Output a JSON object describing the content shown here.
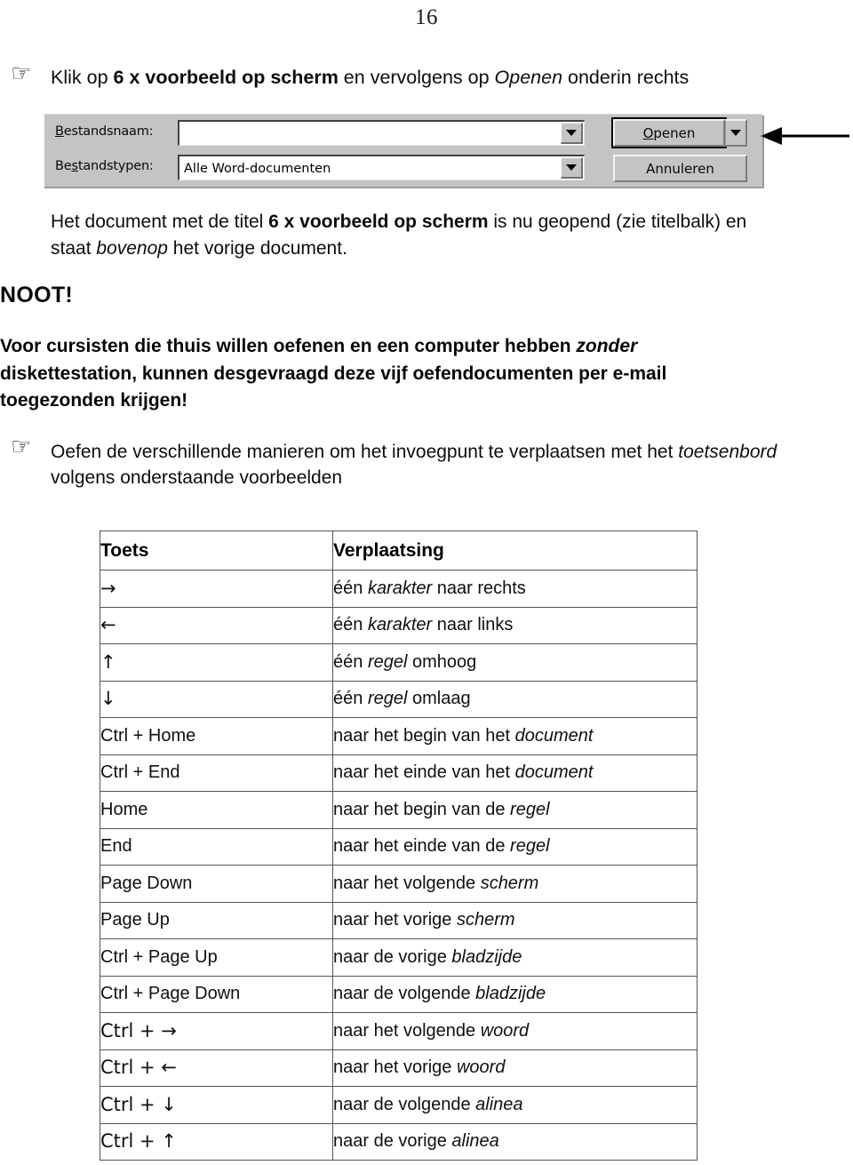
{
  "page": {
    "number": "16"
  },
  "icons": {
    "hand": "☞",
    "dropdown": "chevron-down-icon",
    "annotation_arrow": "left-arrow-icon"
  },
  "instruction_1": {
    "parts": [
      {
        "text": "Klik op ",
        "style": "normal"
      },
      {
        "text": "6 x voorbeeld op scherm",
        "style": "bold"
      },
      {
        "text": " en vervolgens op ",
        "style": "normal"
      },
      {
        "text": "Openen",
        "style": "italic"
      },
      {
        "text": " onderin rechts",
        "style": "normal"
      }
    ],
    "plain": "Klik op 6 x voorbeeld op scherm en vervolgens op Openen onderin rechts"
  },
  "dialog": {
    "name": "open-file-dialog",
    "filename_label": "Bestandsnaam:",
    "filename_label_accel": "B",
    "filename_value": "",
    "filetype_label": "Bestandstypen:",
    "filetype_label_accel": "s",
    "filetype_value": "Alle Word-documenten",
    "open_button": "Openen",
    "open_button_accel": "O",
    "cancel_button": "Annuleren",
    "colors": {
      "face": "#c4c4c4",
      "field": "#ffffff",
      "shadow": "#7d7d7d",
      "highlight": "#f4f4f4"
    }
  },
  "paragraph_1": {
    "parts": [
      {
        "text": "Het document met de titel ",
        "style": "normal"
      },
      {
        "text": "6 x voorbeeld op scherm",
        "style": "bold"
      },
      {
        "text": " is nu geopend (zie titelbalk) en",
        "style": "normal"
      }
    ],
    "line2": [
      {
        "text": "staat ",
        "style": "normal"
      },
      {
        "text": "bovenop",
        "style": "italic"
      },
      {
        "text": " het vorige document.",
        "style": "normal"
      }
    ]
  },
  "noot": {
    "heading": "NOOT!",
    "body_lines": [
      [
        {
          "text": "Voor cursisten die thuis willen oefenen en een computer hebben ",
          "style": "bold"
        },
        {
          "text": "zonder",
          "style": "bold-italic"
        }
      ],
      [
        {
          "text": "diskettestation, kunnen desgevraagd deze vijf oefendocumenten per e-mail",
          "style": "bold"
        }
      ],
      [
        {
          "text": "toegezonden krijgen!",
          "style": "bold"
        }
      ]
    ]
  },
  "instruction_2": {
    "line1": [
      {
        "text": "Oefen de verschillende manieren om het invoegpunt te verplaatsen met het ",
        "style": "normal"
      },
      {
        "text": "toetsenbord",
        "style": "italic"
      }
    ],
    "line2": [
      {
        "text": "volgens onderstaande voorbeelden",
        "style": "normal"
      }
    ]
  },
  "kbd_table": {
    "headers": [
      "Toets",
      "Verplaatsing"
    ],
    "rows": [
      {
        "key": "→",
        "key_is_glyph": true,
        "desc": [
          {
            "text": "één ",
            "style": "normal"
          },
          {
            "text": "karakter",
            "style": "italic"
          },
          {
            "text": " naar rechts",
            "style": "normal"
          }
        ]
      },
      {
        "key": "←",
        "key_is_glyph": true,
        "desc": [
          {
            "text": "één ",
            "style": "normal"
          },
          {
            "text": "karakter",
            "style": "italic"
          },
          {
            "text": " naar links",
            "style": "normal"
          }
        ]
      },
      {
        "key": "↑",
        "key_is_glyph": true,
        "desc": [
          {
            "text": "één ",
            "style": "normal"
          },
          {
            "text": "regel",
            "style": "italic"
          },
          {
            "text": " omhoog",
            "style": "normal"
          }
        ]
      },
      {
        "key": "↓",
        "key_is_glyph": true,
        "desc": [
          {
            "text": "één ",
            "style": "normal"
          },
          {
            "text": "regel",
            "style": "italic"
          },
          {
            "text": " omlaag",
            "style": "normal"
          }
        ]
      },
      {
        "key": "Ctrl + Home",
        "key_is_glyph": false,
        "desc": [
          {
            "text": "naar het begin van het ",
            "style": "normal"
          },
          {
            "text": "document",
            "style": "italic"
          }
        ]
      },
      {
        "key": "Ctrl + End",
        "key_is_glyph": false,
        "desc": [
          {
            "text": "naar het einde van het ",
            "style": "normal"
          },
          {
            "text": "document",
            "style": "italic"
          }
        ]
      },
      {
        "key": "Home",
        "key_is_glyph": false,
        "desc": [
          {
            "text": "naar het begin van de ",
            "style": "normal"
          },
          {
            "text": "regel",
            "style": "italic"
          }
        ]
      },
      {
        "key": "End",
        "key_is_glyph": false,
        "desc": [
          {
            "text": "naar het einde van de ",
            "style": "normal"
          },
          {
            "text": "regel",
            "style": "italic"
          }
        ]
      },
      {
        "key": "Page Down",
        "key_is_glyph": false,
        "desc": [
          {
            "text": "naar het volgende ",
            "style": "normal"
          },
          {
            "text": "scherm",
            "style": "italic"
          }
        ]
      },
      {
        "key": "Page Up",
        "key_is_glyph": false,
        "desc": [
          {
            "text": "naar het vorige ",
            "style": "normal"
          },
          {
            "text": "scherm",
            "style": "italic"
          }
        ]
      },
      {
        "key": "Ctrl + Page Up",
        "key_is_glyph": false,
        "desc": [
          {
            "text": "naar de vorige ",
            "style": "normal"
          },
          {
            "text": "bladzijde",
            "style": "italic"
          }
        ]
      },
      {
        "key": "Ctrl + Page Down",
        "key_is_glyph": false,
        "desc": [
          {
            "text": "naar de volgende ",
            "style": "normal"
          },
          {
            "text": "bladzijde",
            "style": "italic"
          }
        ]
      },
      {
        "key": "Ctrl + →",
        "key_is_glyph": true,
        "desc": [
          {
            "text": "naar het volgende ",
            "style": "normal"
          },
          {
            "text": "woord",
            "style": "italic"
          }
        ]
      },
      {
        "key": "Ctrl + ←",
        "key_is_glyph": true,
        "desc": [
          {
            "text": "naar het vorige ",
            "style": "normal"
          },
          {
            "text": "woord",
            "style": "italic"
          }
        ]
      },
      {
        "key": "Ctrl + ↓",
        "key_is_glyph": true,
        "desc": [
          {
            "text": "naar de volgende ",
            "style": "normal"
          },
          {
            "text": "alinea",
            "style": "italic"
          }
        ]
      },
      {
        "key": "Ctrl + ↑",
        "key_is_glyph": true,
        "desc": [
          {
            "text": "naar de vorige ",
            "style": "normal"
          },
          {
            "text": "alinea",
            "style": "italic"
          }
        ]
      }
    ]
  }
}
